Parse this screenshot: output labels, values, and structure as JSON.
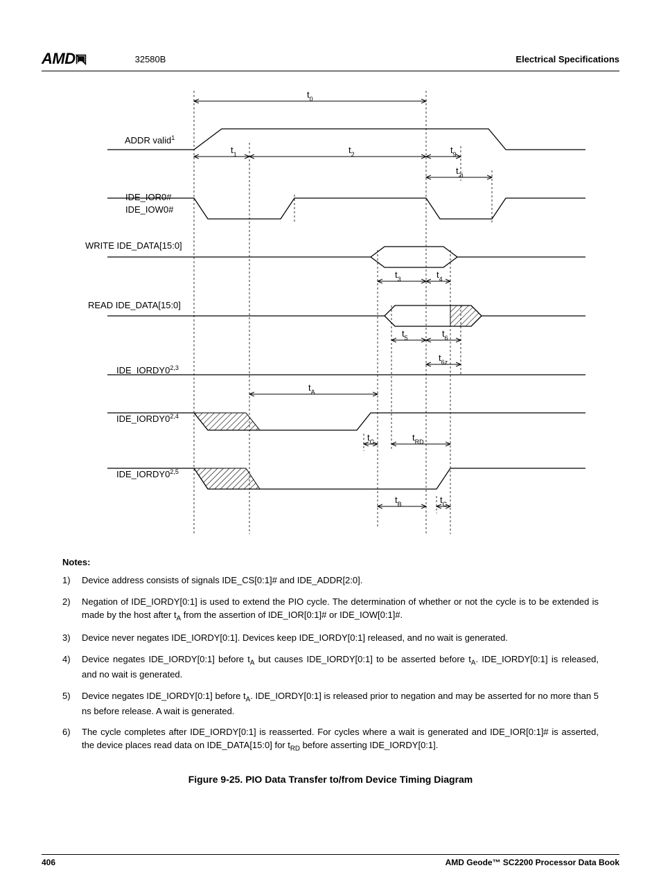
{
  "header": {
    "logo_text": "AMD",
    "doc_number": "32580B",
    "section_title": "Electrical Specifications"
  },
  "diagram": {
    "signal_labels": {
      "addr_valid": "ADDR valid",
      "addr_valid_sup": "1",
      "ide_ior0": "IDE_IOR0#",
      "ide_iow0": "IDE_IOW0#",
      "write_data": "WRITE IDE_DATA[15:0]",
      "read_data": "READ IDE_DATA[15:0]",
      "ide_iordy_a": "IDE_IORDY0",
      "ide_iordy_a_sup": "2,3",
      "ide_iordy_b": "IDE_IORDY0",
      "ide_iordy_b_sup": "2,4",
      "ide_iordy_c": "IDE_IORDY0",
      "ide_iordy_c_sup": "2,5"
    },
    "timing_labels": {
      "t0": "t",
      "t0_sub": "0",
      "t1": "t",
      "t1_sub": "1",
      "t2": "t",
      "t2_sub": "2",
      "t9": "t",
      "t9_sub": "9",
      "t2i": "t",
      "t2i_sub": "2i",
      "t3": "t",
      "t3_sub": "3",
      "t4": "t",
      "t4_sub": "4",
      "t5": "t",
      "t5_sub": "5",
      "t6": "t",
      "t6_sub": "6",
      "t6z": "t",
      "t6z_sub": "6z",
      "tA": "t",
      "tA_sub": "A",
      "tC": "t",
      "tC_sub": "C",
      "tRD": "t",
      "tRD_sub": "RD",
      "tB": "t",
      "tB_sub": "B"
    }
  },
  "notes": {
    "heading": "Notes:",
    "items": [
      {
        "num": "1)",
        "text": "Device address consists of signals IDE_CS[0:1]# and IDE_ADDR[2:0]."
      },
      {
        "num": "2)",
        "text": "Negation of IDE_IORDY[0:1] is used to extend the PIO cycle. The determination of whether or not the cycle is to be extended is made by the host after t<sub>A</sub> from the assertion of IDE_IOR[0:1]# or IDE_IOW[0:1]#."
      },
      {
        "num": "3)",
        "text": "Device never negates IDE_IORDY[0:1]. Devices keep IDE_IORDY[0:1] released, and no wait is generated."
      },
      {
        "num": "4)",
        "text": "Device negates IDE_IORDY[0:1] before t<sub>A</sub> but causes IDE_IORDY[0:1] to be asserted before t<sub>A</sub>. IDE_IORDY[0:1] is released, and no wait is generated."
      },
      {
        "num": "5)",
        "text": "Device negates IDE_IORDY[0:1] before t<sub>A</sub>. IDE_IORDY[0:1] is released prior to negation and may be asserted for no more than 5 ns before release. A wait is generated."
      },
      {
        "num": "6)",
        "text": "The cycle completes after IDE_IORDY[0:1] is reasserted. For cycles where a wait is generated and IDE_IOR[0:1]# is asserted, the device places read data on IDE_DATA[15:0] for t<sub>RD</sub> before asserting IDE_IORDY[0:1]."
      }
    ]
  },
  "figure_caption": "Figure 9-25.  PIO Data Transfer to/from Device Timing Diagram",
  "footer": {
    "page_number": "406",
    "book_title": "AMD Geode™ SC2200  Processor Data Book"
  }
}
